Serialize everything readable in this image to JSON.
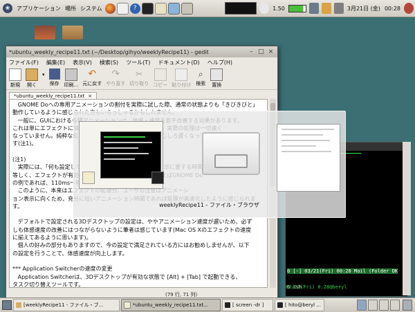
{
  "top_panel": {
    "menus": [
      "アプリケーション",
      "場所",
      "システム"
    ],
    "volume_text": "1.50",
    "date": "3月21日 (金)",
    "time": "00:28"
  },
  "gedit": {
    "title": "*ubuntu_weekly_recipe11.txt (~/Desktop/gihyo/weeklyRecipe11) - gedit",
    "menu": [
      "ファイル(F)",
      "編集(E)",
      "表示(V)",
      "検索(S)",
      "ツール(T)",
      "ドキュメント(D)",
      "ヘルプ(H)"
    ],
    "toolbar": {
      "new": "新規",
      "open": "開く",
      "save": "保存",
      "print": "印刷...",
      "undo": "元に戻す",
      "redo": "やり直す",
      "cut": "切り取り",
      "copy": "コピー",
      "paste": "貼り付け",
      "find": "検索",
      "replace": "置換"
    },
    "tab_label": "*ubuntu_weekly_recipe11.txt",
    "lines": [
      "   GNOME Doへの専用アニメーションの割付を実際に試した際、通常の状態よりも「きびきびと」",
      "動作しているように感じられた方もいらっしゃるかもしれません。",
      "   一般に、GUIにおける各種アニメーションは、体感・速度を若干改善する効果があります。",
      "これは単にエフェクトに慣れた人間側が錯覚しているだけで、実際の処理は一切速く",
      "なっていません。純粋な処理速度を最優先するのであれば、むしろ遅くなっていま",
      "す(注1)。",
      "",
      "(注1)",
      "   実際には、「何も設定していない」状態でも、エフェクト表示に要する時間はほぼ",
      "等しく、エフェクトが有効の場合は若干の差が出ます。たとえばGNOME Do",
      "の例であれば、110ms～程度の遅延が発生します。",
      "   このように、本来はエフェクトの処理分、ユーザの注意はアニメーシ",
      "ョン表示に向くため、充分に短いアニメーション時間であれば処理が高速化したように感じられま",
      "す。",
      "",
      "   デフォルトで設定される3Dデスクトップの設定は、ややアニメーション速度が遅いため、必ず",
      "しも体感速度の改善にはつながらないように筆者は感じています(Mac OS Xのエフェクトの速度",
      "に揃えてあるように思います)。",
      "   個人の好みの部分もありますので、今の設定で満足されている方にはお勧めしませんが、以下",
      "の設定を行うことで、体感速度が向上します。",
      "",
      "*** Application Switcherの速度の変更",
      "   Application Switcherは、3Dデスクトップが有効な状態で [Alt] + [Tab] で起動できる、",
      "タスク切り替えツールです。"
    ],
    "status": "(79 行, 71 列)"
  },
  "switcher": {
    "caption": "weeklyRecipe11 - ファイル・ブラウザ"
  },
  "terminal": {
    "status_line": "0  [-]  03/21(Fri) 00:28  Mail (Folder DK",
    "bottom_line": "6 zsh",
    "bottom_right": "03/21(Fri) 0:28@beryl"
  },
  "taskbar": {
    "items": [
      "[weeklyRecipe11 - ファイル・ブ...",
      "*ubuntu_weekly_recipe11.txt...",
      "[ screen -dr ]",
      "[ hito@beryl ..."
    ]
  },
  "colors": {
    "desktop": "#3b6f74",
    "panel": "#dcd8d0",
    "terminal_bg": "#000000",
    "terminal_green": "#3bd24a"
  }
}
